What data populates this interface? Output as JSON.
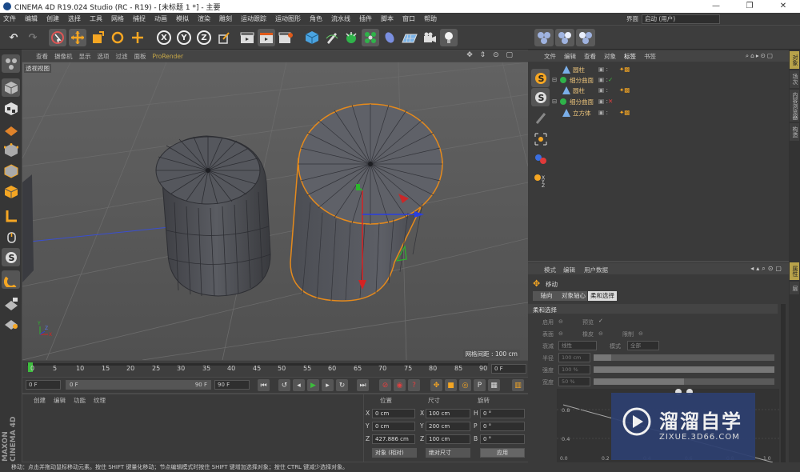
{
  "window": {
    "title": "CINEMA 4D R19.024 Studio (RC - R19) - [未标题 1 *] - 主要",
    "min": "—",
    "max": "❐",
    "close": "✕"
  },
  "menu": [
    "文件",
    "编辑",
    "创建",
    "选择",
    "工具",
    "网格",
    "捕捉",
    "动画",
    "模拟",
    "渲染",
    "雕刻",
    "运动跟踪",
    "运动图形",
    "角色",
    "流水线",
    "插件",
    "脚本",
    "窗口",
    "帮助"
  ],
  "layout": {
    "label": "界面",
    "value": "启动 (用户)"
  },
  "toolbar": {
    "undo": "↶",
    "redo": "↷",
    "x_axis": "X",
    "y_axis": "Y",
    "z_axis": "Z"
  },
  "viewport": {
    "menu": [
      "查看",
      "摄像机",
      "显示",
      "选项",
      "过滤",
      "面板",
      "ProRender"
    ],
    "label": "透视视图",
    "grid_spacing": "网格间距 : 100 cm",
    "icons": "✥ ⇕ ⊙ ▢"
  },
  "timeline": {
    "ticks": [
      "0",
      "5",
      "10",
      "15",
      "20",
      "25",
      "30",
      "35",
      "40",
      "45",
      "50",
      "55",
      "60",
      "65",
      "70",
      "75",
      "80",
      "85",
      "90"
    ],
    "current_frame": "0 F"
  },
  "time_controls": {
    "start": "0 F",
    "current": "0 F",
    "range_end": "90 F",
    "end": "90 F"
  },
  "material": {
    "menu": [
      "创建",
      "编辑",
      "功能",
      "纹理"
    ]
  },
  "logo": "MAXON CINEMA 4D",
  "coords": {
    "headers": {
      "position": "位置",
      "size": "尺寸",
      "rotation": "旋转"
    },
    "rows": [
      {
        "axis": "X",
        "pos": "0 cm",
        "size_axis": "X",
        "size": "100 cm",
        "rot_axis": "H",
        "rot": "0 °"
      },
      {
        "axis": "Y",
        "pos": "0 cm",
        "size_axis": "Y",
        "size": "200 cm",
        "rot_axis": "P",
        "rot": "0 °"
      },
      {
        "axis": "Z",
        "pos": "427.886 cm",
        "size_axis": "Z",
        "size": "100 cm",
        "rot_axis": "B",
        "rot": "0 °"
      }
    ],
    "mode_object": "对象 (相对)",
    "mode_size": "绝对尺寸",
    "apply": "应用"
  },
  "status": "移动：点击并拖动鼠标移动元素。按住 SHIFT 键量化移动；节点编辑模式时按住 SHIFT 键增加选择对象；按住 CTRL 键减少选择对象。",
  "object_manager": {
    "menu": [
      "文件",
      "编辑",
      "查看",
      "对象",
      "标签",
      "书签"
    ],
    "objects": [
      {
        "name": "圆柱",
        "indent": 1
      },
      {
        "name": "细分曲面",
        "indent": 0
      },
      {
        "name": "圆柱",
        "indent": 1
      },
      {
        "name": "细分曲面",
        "indent": 0
      },
      {
        "name": "立方体",
        "indent": 1
      }
    ]
  },
  "attribute_manager": {
    "menu": [
      "模式",
      "编辑",
      "用户数据"
    ],
    "tool": "移动",
    "tabs": [
      "轴向",
      "对象轴心",
      "柔和选择"
    ],
    "section": "柔和选择",
    "rows": {
      "enable": "启用",
      "preview": "预览",
      "surface": "表面",
      "rubber": "橡皮",
      "restrict": "限制",
      "falloff": "衰减",
      "falloff_value": "线性",
      "mode": "模式",
      "mode_value": "全部",
      "radius": "半径",
      "radius_value": "100 cm",
      "strength": "强度",
      "strength_value": "100 %",
      "width": "宽度",
      "width_value": "50 %"
    },
    "graph": {
      "ticks_y": [
        "0.8",
        "0.4"
      ],
      "ticks_x": [
        "0.0",
        "0.2",
        "0.4",
        "0.6",
        "0.8",
        "1.0"
      ]
    }
  },
  "right_tabs": [
    "对象",
    "场次",
    "内容浏览器",
    "构造"
  ],
  "right_tabs_attr": [
    "属性",
    "层"
  ],
  "watermark": {
    "title": "溜溜自学",
    "url": "ZIXUE.3D66.COM"
  }
}
